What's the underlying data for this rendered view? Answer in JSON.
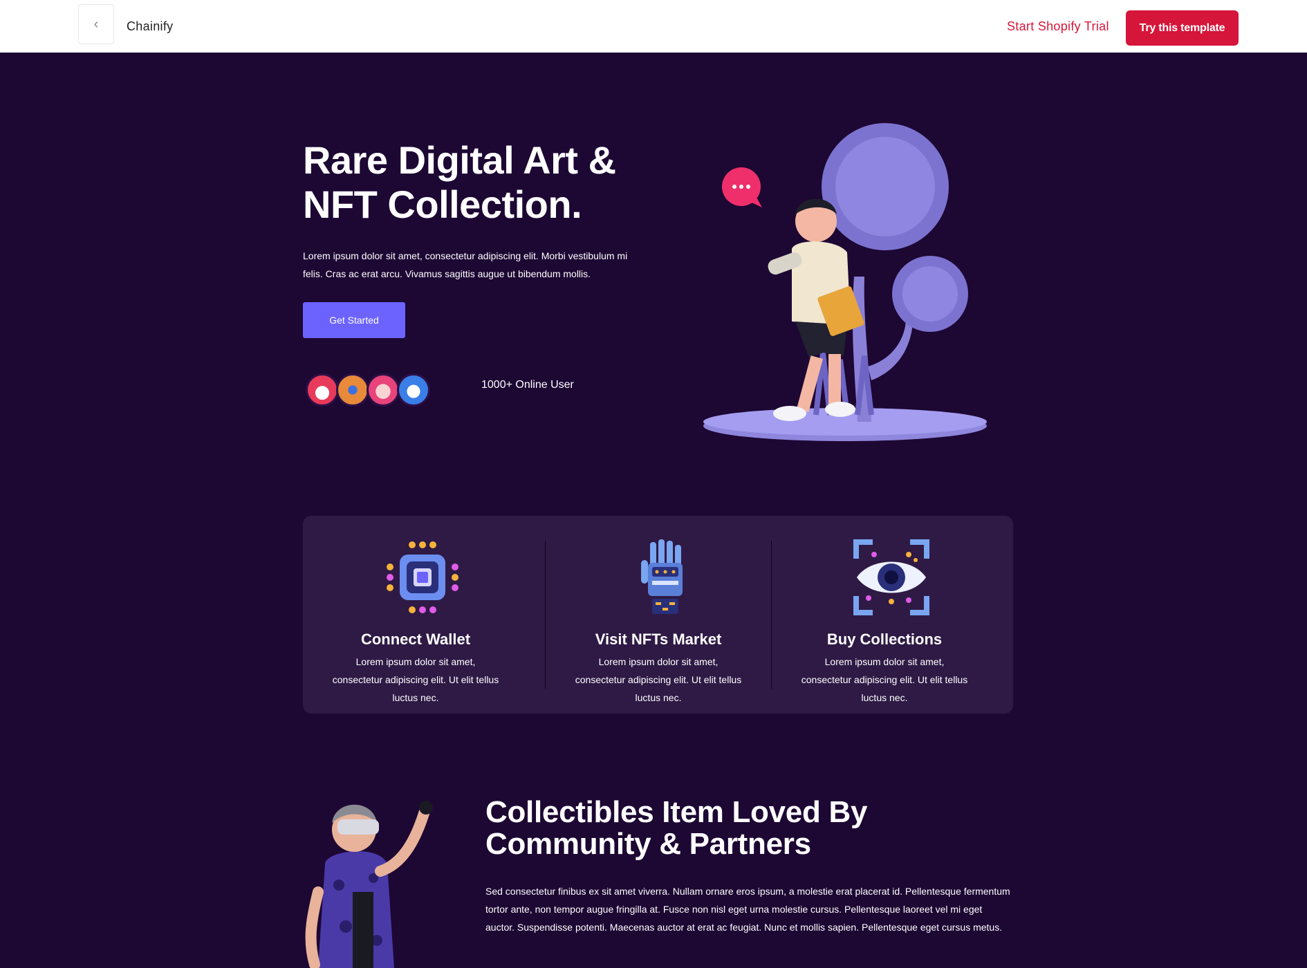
{
  "topbar": {
    "back_icon": "chevron-left-icon",
    "brand": "Chainify",
    "trial_link": "Start Shopify Trial",
    "try_button": "Try this template",
    "accent": "#d6153a"
  },
  "hero": {
    "title": "Rare Digital Art & NFT Collection.",
    "description": "Lorem ipsum dolor sit amet, consectetur adipiscing elit. Morbi vestibulum mi felis. Cras ac erat arcu. Vivamus sagittis augue ut bibendum mollis.",
    "cta": "Get Started",
    "cta_color": "#6c63ff",
    "online_users": "1000+ Online User",
    "avatars": [
      "robot-avatar-red",
      "robot-avatar-orange",
      "robot-avatar-pink",
      "robot-avatar-blue"
    ]
  },
  "features": [
    {
      "icon": "chip-icon",
      "title": "Connect Wallet",
      "description": "Lorem ipsum dolor sit amet, consectetur adipiscing elit. Ut elit tellus luctus nec."
    },
    {
      "icon": "robot-hand-icon",
      "title": "Visit NFTs Market",
      "description": "Lorem ipsum dolor sit amet, consectetur adipiscing elit. Ut elit tellus luctus nec."
    },
    {
      "icon": "eye-scan-icon",
      "title": "Buy Collections",
      "description": "Lorem ipsum dolor sit amet, consectetur adipiscing elit. Ut elit tellus luctus nec."
    }
  ],
  "community": {
    "title": "Collectibles Item Loved By Community & Partners",
    "description": "Sed consectetur finibus ex sit amet viverra. Nullam ornare eros ipsum, a molestie erat placerat id. Pellentesque fermentum tortor ante, non tempor augue fringilla at. Fusce non nisl eget urna molestie cursus. Pellentesque laoreet vel mi eget auctor. Suspendisse potenti. Maecenas auctor at erat ac feugiat. Nunc et mollis sapien. Pellentesque eget cursus metus."
  },
  "colors": {
    "background": "#1d0733",
    "card": "#2e1a45"
  }
}
